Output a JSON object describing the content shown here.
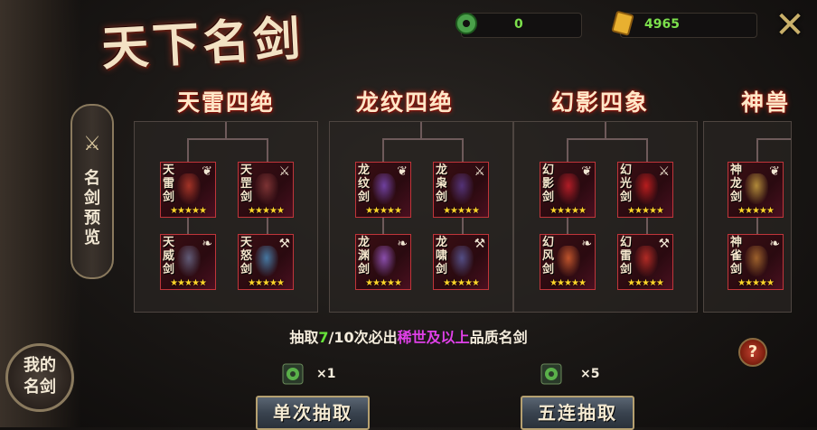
{
  "title": "天下名剑",
  "currency": {
    "jade": {
      "value": "0",
      "icon": "jade-ring-icon"
    },
    "gold": {
      "value": "4965",
      "icon": "gold-ticket-icon"
    }
  },
  "close_icon": "close-icon",
  "side_tab": {
    "label": [
      "名",
      "剑",
      "预",
      "览"
    ],
    "icon": "crossed-swords-icon"
  },
  "my_swords": {
    "label_line1": "我的",
    "label_line2": "名剑"
  },
  "sets": [
    {
      "name": "天雷四绝",
      "cards": [
        {
          "name": [
            "天",
            "雷",
            "剑"
          ],
          "emblem": "wing-emblem",
          "color": "#b83a2a",
          "stars": "★★★★★"
        },
        {
          "name": [
            "天",
            "罡",
            "剑"
          ],
          "emblem": "crossed-swords-emblem",
          "color": "#8a3a3a",
          "stars": "★★★★★"
        },
        {
          "name": [
            "天",
            "威",
            "剑"
          ],
          "emblem": "feather-emblem",
          "color": "#6a6a8a",
          "stars": "★★★★★"
        },
        {
          "name": [
            "天",
            "怒",
            "剑"
          ],
          "emblem": "axe-emblem",
          "color": "#4a8aba",
          "stars": "★★★★★"
        }
      ]
    },
    {
      "name": "龙纹四绝",
      "cards": [
        {
          "name": [
            "龙",
            "纹",
            "剑"
          ],
          "emblem": "wing-emblem",
          "color": "#7a4ab8",
          "stars": "★★★★★"
        },
        {
          "name": [
            "龙",
            "枭",
            "剑"
          ],
          "emblem": "crossed-swords-emblem",
          "color": "#5a3a8a",
          "stars": "★★★★★"
        },
        {
          "name": [
            "龙",
            "渊",
            "剑"
          ],
          "emblem": "feather-emblem",
          "color": "#9a5ac8",
          "stars": "★★★★★"
        },
        {
          "name": [
            "龙",
            "啸",
            "剑"
          ],
          "emblem": "axe-emblem",
          "color": "#5a5a9a",
          "stars": "★★★★★"
        }
      ]
    },
    {
      "name": "幻影四象",
      "cards": [
        {
          "name": [
            "幻",
            "影",
            "剑"
          ],
          "emblem": "wing-emblem",
          "color": "#c8202a",
          "stars": "★★★★★"
        },
        {
          "name": [
            "幻",
            "光",
            "剑"
          ],
          "emblem": "crossed-swords-emblem",
          "color": "#d02020",
          "stars": "★★★★★"
        },
        {
          "name": [
            "幻",
            "风",
            "剑"
          ],
          "emblem": "feather-emblem",
          "color": "#d86030",
          "stars": "★★★★★"
        },
        {
          "name": [
            "幻",
            "雷",
            "剑"
          ],
          "emblem": "axe-emblem",
          "color": "#c83028",
          "stars": "★★★★★"
        }
      ]
    },
    {
      "name": "神兽",
      "cards": [
        {
          "name": [
            "神",
            "龙",
            "剑"
          ],
          "emblem": "wing-emblem",
          "color": "#c8a040",
          "stars": "★★★★★"
        },
        {
          "name": [
            "神",
            "雀",
            "剑"
          ],
          "emblem": "feather-emblem",
          "color": "#b07030",
          "stars": "★★★★★"
        }
      ]
    }
  ],
  "info": {
    "prefix": "抽取",
    "count": "7",
    "mid": "/10次必出",
    "quality": "稀世及以上",
    "suffix": "品质名剑"
  },
  "help_label": "?",
  "single_draw": {
    "cost": "×1",
    "label": "单次抽取",
    "icon": "jade-ring-icon"
  },
  "five_draw": {
    "cost": "×5",
    "label": "五连抽取",
    "icon": "jade-ring-icon"
  }
}
